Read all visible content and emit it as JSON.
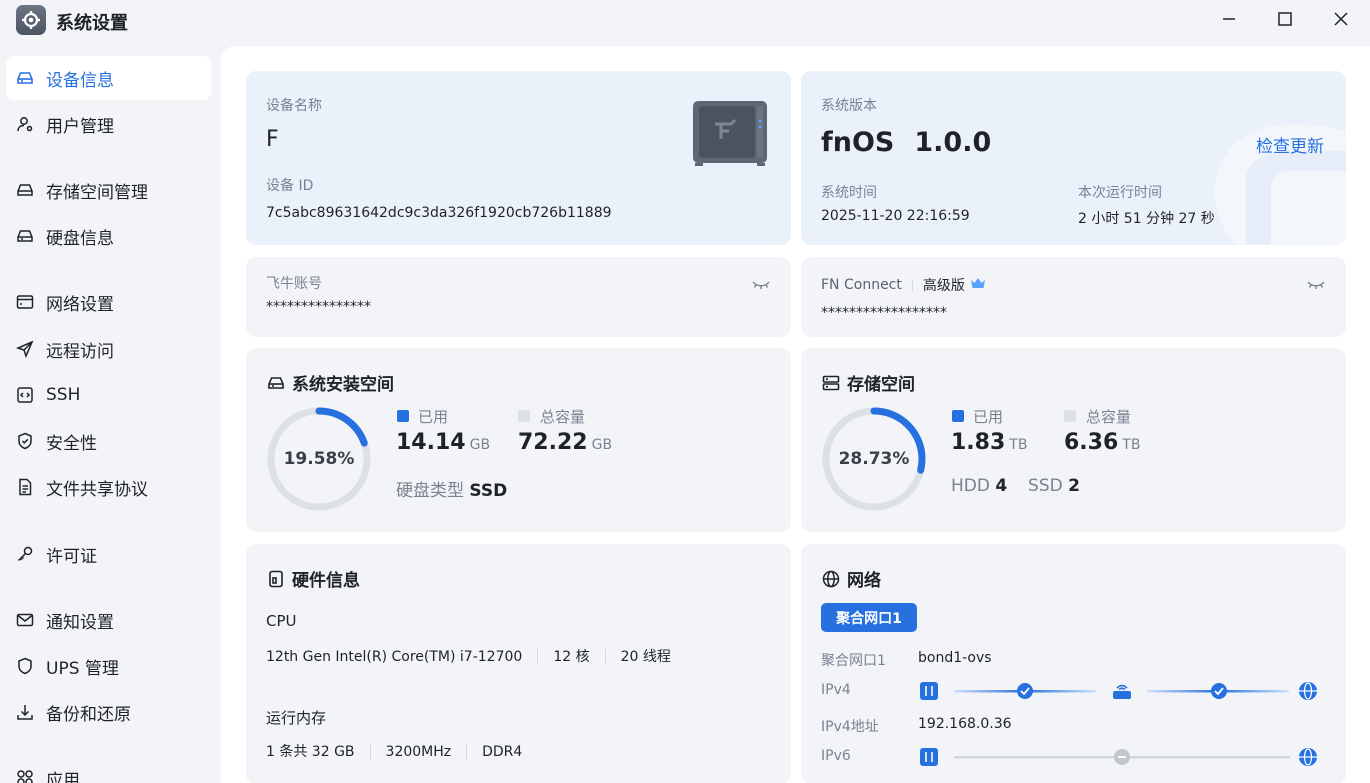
{
  "window": {
    "title": "系统设置"
  },
  "sidebar": {
    "items": [
      {
        "label": "设备信息",
        "icon": "device-icon",
        "active": true
      },
      {
        "label": "用户管理",
        "icon": "user-icon"
      },
      {
        "label": "存储空间管理",
        "icon": "storage-icon"
      },
      {
        "label": "硬盘信息",
        "icon": "disk-icon"
      },
      {
        "label": "网络设置",
        "icon": "network-icon"
      },
      {
        "label": "远程访问",
        "icon": "send-icon"
      },
      {
        "label": "SSH",
        "icon": "code-icon"
      },
      {
        "label": "安全性",
        "icon": "shield-icon"
      },
      {
        "label": "文件共享协议",
        "icon": "file-icon"
      },
      {
        "label": "许可证",
        "icon": "key-icon"
      },
      {
        "label": "通知设置",
        "icon": "mail-icon"
      },
      {
        "label": "UPS 管理",
        "icon": "ups-icon"
      },
      {
        "label": "备份和还原",
        "icon": "backup-icon"
      },
      {
        "label": "应用",
        "icon": "apps-icon"
      }
    ]
  },
  "device": {
    "name_label": "设备名称",
    "name": "F",
    "id_label": "设备 ID",
    "id": "7c5abc89631642dc9c3da326f1920cb726b11889"
  },
  "system": {
    "version_label": "系统版本",
    "os": "fnOS",
    "version": "1.0.0",
    "check_update": "检查更新",
    "time_label": "系统时间",
    "time": "2025-11-20 22:16:59",
    "uptime_label": "本次运行时间",
    "uptime": "2 小时 51 分钟 27 秒"
  },
  "account": {
    "label": "飞牛账号",
    "value": "***************"
  },
  "fn_connect": {
    "label": "FN Connect",
    "tier": "高级版",
    "value": "******************"
  },
  "install_space": {
    "title": "系统安装空间",
    "percent_text": "19.58%",
    "percent": 19.58,
    "used_label": "已用",
    "used": "14.14",
    "used_unit": "GB",
    "total_label": "总容量",
    "total": "72.22",
    "total_unit": "GB",
    "disk_type_label": "硬盘类型",
    "disk_type": "SSD"
  },
  "storage_space": {
    "title": "存储空间",
    "percent_text": "28.73%",
    "percent": 28.73,
    "used_label": "已用",
    "used": "1.83",
    "used_unit": "TB",
    "total_label": "总容量",
    "total": "6.36",
    "total_unit": "TB",
    "hdd_label": "HDD",
    "hdd": "4",
    "ssd_label": "SSD",
    "ssd": "2"
  },
  "hardware": {
    "title": "硬件信息",
    "cpu_label": "CPU",
    "cpu_model": "12th Gen Intel(R) Core(TM) i7-12700",
    "cpu_cores": "12 核",
    "cpu_threads": "20 线程",
    "mem_label": "运行内存",
    "mem_count": "1 条共 32 GB",
    "mem_speed": "3200MHz",
    "mem_type": "DDR4"
  },
  "network": {
    "title": "网络",
    "tab": "聚合网口1",
    "iface_label": "聚合网口1",
    "iface": "bond1-ovs",
    "ipv4_label": "IPv4",
    "ipv4_addr_label": "IPv4地址",
    "ipv4_addr": "192.168.0.36",
    "ipv6_label": "IPv6"
  },
  "colors": {
    "accent": "#2670e0",
    "ring_track": "#dde1e7",
    "card_bg": "#f2f4f8",
    "card_blue": "#ebf1fb"
  }
}
